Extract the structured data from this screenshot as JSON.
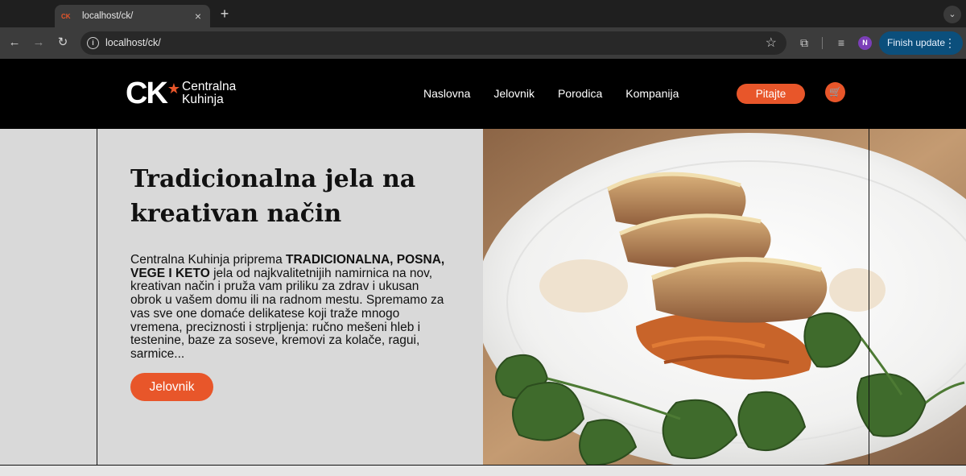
{
  "browser": {
    "tab_title": "localhost/ck/",
    "tab_favicon": "CK",
    "new_tab": "+",
    "url": "localhost/ck/",
    "update_button": "Finish update",
    "profile_initial": "N"
  },
  "site": {
    "logo": {
      "mark": "CK",
      "name_line1": "Centralna",
      "name_line2": "Kuhinja"
    },
    "nav": [
      "Naslovna",
      "Jelovnik",
      "Porodica",
      "Kompanija"
    ],
    "ask_button": "Pitajte",
    "cart_icon": "cart-icon",
    "accent_color": "#e8562a"
  },
  "hero": {
    "title": "Tradicionalna jela na kreativan način",
    "text_before": "Centralna Kuhinja priprema ",
    "text_bold": "TRADICIONALNA, POSNA, VEGE I KETO",
    "text_after": " jela od najkvalitetnijih namirnica na nov, kreativan način i pruža vam priliku za zdrav i ukusan obrok u vašem domu ili na radnom mestu. Spremamo za vas sve one domaće delikatese koji traže mnogo vremena, preciznosti i strpljenja: ručno mešeni hleb i testenine, baze za soseve, kremovi za kolače, ragui, sarmice...",
    "button": "Jelovnik"
  }
}
